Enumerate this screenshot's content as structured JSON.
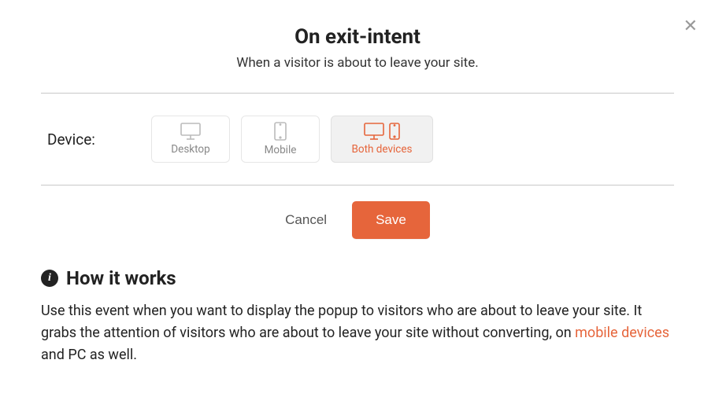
{
  "header": {
    "title": "On exit-intent",
    "subtitle": "When a visitor is about to leave your site."
  },
  "device_row": {
    "label": "Device:",
    "options": {
      "desktop": "Desktop",
      "mobile": "Mobile",
      "both": "Both devices"
    },
    "selected": "both"
  },
  "actions": {
    "cancel": "Cancel",
    "save": "Save"
  },
  "how": {
    "heading": "How it works",
    "text_before": "Use this event when you want to display the popup to visitors who are about to leave your site. It grabs the attention of visitors who are about to leave your site without converting, on ",
    "link": "mobile devices",
    "text_after": " and PC as well."
  },
  "colors": {
    "accent": "#e6653b"
  }
}
